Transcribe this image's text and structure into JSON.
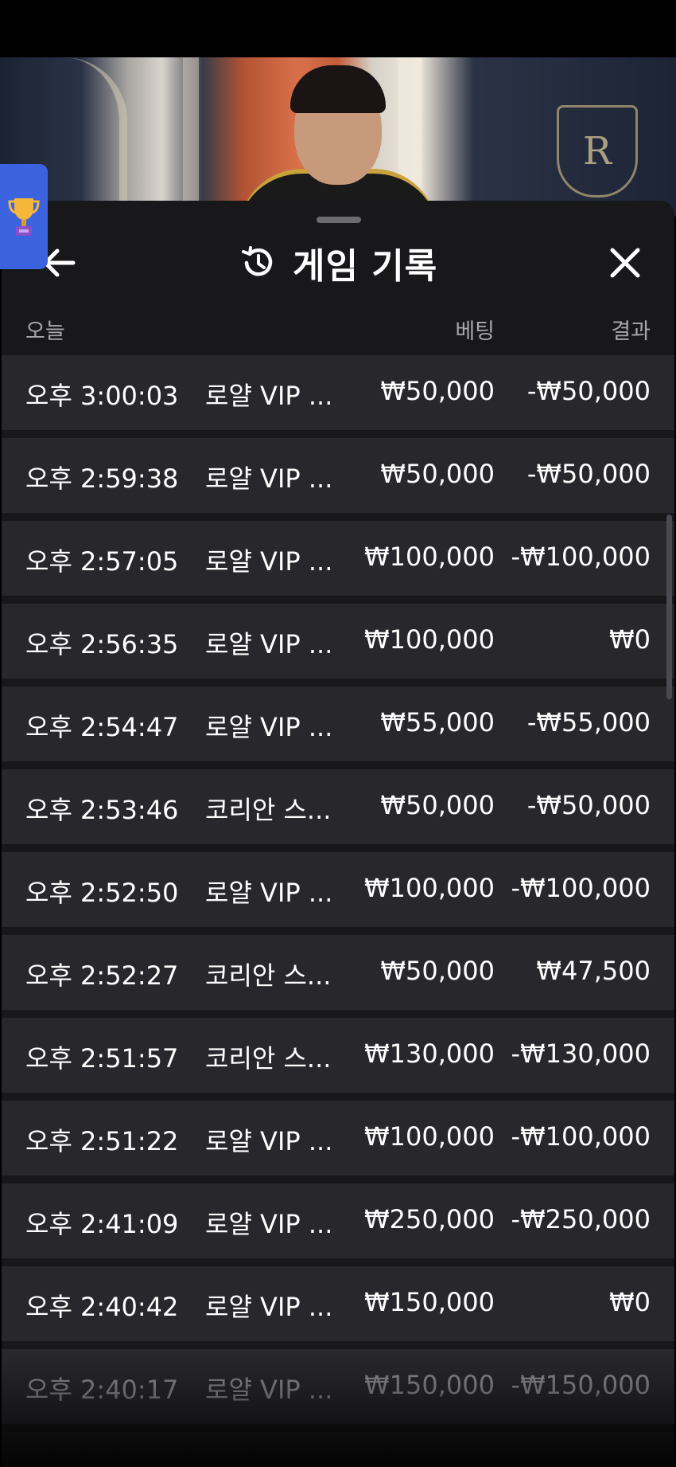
{
  "video": {
    "crest_letter": "R"
  },
  "header": {
    "title": "게임 기록"
  },
  "columns": {
    "date_label": "오늘",
    "bet_label": "베팅",
    "result_label": "결과"
  },
  "rows": [
    {
      "time": "오후 3:00:03",
      "game": "로얄 VIP ...",
      "bet": "₩50,000",
      "result": "-₩50,000"
    },
    {
      "time": "오후 2:59:38",
      "game": "로얄 VIP ...",
      "bet": "₩50,000",
      "result": "-₩50,000"
    },
    {
      "time": "오후 2:57:05",
      "game": "로얄 VIP ...",
      "bet": "₩100,000",
      "result": "-₩100,000"
    },
    {
      "time": "오후 2:56:35",
      "game": "로얄 VIP ...",
      "bet": "₩100,000",
      "result": "₩0"
    },
    {
      "time": "오후 2:54:47",
      "game": "로얄 VIP ...",
      "bet": "₩55,000",
      "result": "-₩55,000"
    },
    {
      "time": "오후 2:53:46",
      "game": "코리안 스...",
      "bet": "₩50,000",
      "result": "-₩50,000"
    },
    {
      "time": "오후 2:52:50",
      "game": "로얄 VIP ...",
      "bet": "₩100,000",
      "result": "-₩100,000"
    },
    {
      "time": "오후 2:52:27",
      "game": "코리안 스...",
      "bet": "₩50,000",
      "result": "₩47,500"
    },
    {
      "time": "오후 2:51:57",
      "game": "코리안 스...",
      "bet": "₩130,000",
      "result": "-₩130,000"
    },
    {
      "time": "오후 2:51:22",
      "game": "로얄 VIP ...",
      "bet": "₩100,000",
      "result": "-₩100,000"
    },
    {
      "time": "오후 2:41:09",
      "game": "로얄 VIP ...",
      "bet": "₩250,000",
      "result": "-₩250,000"
    },
    {
      "time": "오후 2:40:42",
      "game": "로얄 VIP ...",
      "bet": "₩150,000",
      "result": "₩0"
    },
    {
      "time": "오후 2:40:17",
      "game": "로얄 VIP ...",
      "bet": "₩150,000",
      "result": "-₩150,000"
    }
  ],
  "icons": {
    "back": "arrow-left-icon",
    "history": "history-icon",
    "close": "close-icon",
    "trophy": "trophy-icon"
  },
  "colors": {
    "panel_bg": "#18181b",
    "row_bg": "#28282c",
    "header_text": "#a7a7ad",
    "trophy_tab": "#3b63e0"
  }
}
